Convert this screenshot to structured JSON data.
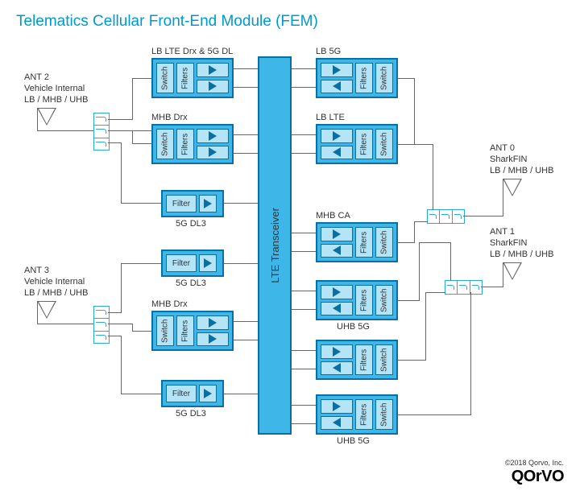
{
  "title": "Telematics Cellular Front-End Module (FEM)",
  "copyright": "©2018 Qorvo, Inc.",
  "logo": "QOrVO",
  "antennas": {
    "ant2": {
      "name": "ANT 2",
      "desc": "Vehicle Internal",
      "bands": "LB / MHB / UHB"
    },
    "ant3": {
      "name": "ANT 3",
      "desc": "Vehicle Internal",
      "bands": "LB / MHB / UHB"
    },
    "ant0": {
      "name": "ANT 0",
      "desc": "SharkFIN",
      "bands": "LB / MHB / UHB"
    },
    "ant1": {
      "name": "ANT 1",
      "desc": "SharkFIN",
      "bands": "LB / MHB / UHB"
    }
  },
  "transceiver": "LTE Transceiver",
  "left_modules": {
    "m1": {
      "label": "LB LTE Drx & 5G DL",
      "switch": "Switch",
      "filters": "Filters"
    },
    "m2": {
      "label": "MHB Drx",
      "switch": "Switch",
      "filters": "Filters"
    },
    "m3": {
      "label": "5G DL3",
      "filter": "Filter"
    },
    "m4": {
      "label": "5G DL3",
      "filter": "Filter"
    },
    "m5": {
      "label": "MHB Drx",
      "switch": "Switch",
      "filters": "Filters"
    },
    "m6": {
      "label": "5G DL3",
      "filter": "Filter"
    }
  },
  "right_modules": {
    "r1": {
      "label": "LB 5G",
      "switch": "Switch",
      "filters": "Filters"
    },
    "r2": {
      "label": "LB LTE",
      "switch": "Switch",
      "filters": "Filters"
    },
    "r3": {
      "label": "MHB CA",
      "switch": "Switch",
      "filters": "Filters"
    },
    "r4": {
      "label": "UHB 5G",
      "switch": "Switch",
      "filters": "Filters"
    },
    "r5": {
      "label": "UHB 5G",
      "switch": "Switch",
      "filters": "Filters"
    },
    "rextra": {
      "switch": "Switch",
      "filters": "Filters"
    }
  }
}
